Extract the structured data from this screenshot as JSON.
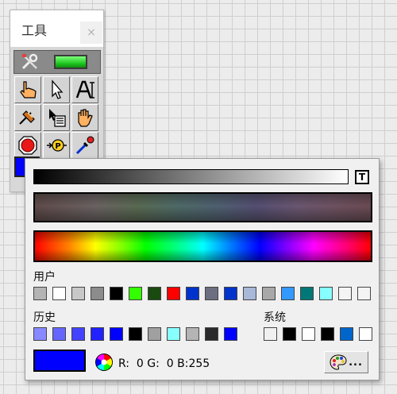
{
  "tools_window": {
    "title": "工具",
    "close_glyph": "×",
    "icons": {
      "auto_tool": "wrench-screwdriver-icon",
      "auto_led": "green-led-icon",
      "operate": "pointing-hand-icon",
      "position": "arrow-cursor-icon",
      "label": "text-label-icon",
      "wire": "wiring-spool-icon",
      "shortcut_menu": "shortcut-menu-icon",
      "scroll": "grab-hand-icon",
      "breakpoint": "breakpoint-stop-icon",
      "probe": "probe-icon",
      "get_color": "eyedropper-icon"
    },
    "current_color": "#0000ff"
  },
  "color_picker": {
    "transparent_label": "T",
    "user_label": "用户",
    "history_label": "历史",
    "system_label": "系统",
    "user_colors": [
      "#b4b4b4",
      "#ffffff",
      "#c8c8c8",
      "#8c8c8c",
      "#000000",
      "#33ff00",
      "#1a4a10",
      "#ff0000",
      "#0033cc",
      "#6e6e82",
      "#0033cc",
      "#a8b8d8",
      "#a8a8a8",
      "#3399ff",
      "#007878",
      "#88ffff",
      "#f4f4f4",
      "#f4f4f4"
    ],
    "history_colors": [
      "#8888ff",
      "#6666ff",
      "#4444ff",
      "#2222ff",
      "#0000ff",
      "#000000",
      "#a0a0a0",
      "#88ffff",
      "#b4b4b4",
      "#2a2a2a",
      "#0000ff"
    ],
    "system_colors": [
      "#f0f0f0",
      "#000000",
      "#ffffff",
      "#000000",
      "#0066cc",
      "#ffffff"
    ],
    "selected_color": "#0000ff",
    "rgb": {
      "r_label": "R:",
      "r": "0",
      "g_label": "G:",
      "g": "0",
      "b_label": "B:",
      "b": "255"
    },
    "palette_button_icon": "color-palette-icon",
    "palette_button_dots": "..."
  }
}
